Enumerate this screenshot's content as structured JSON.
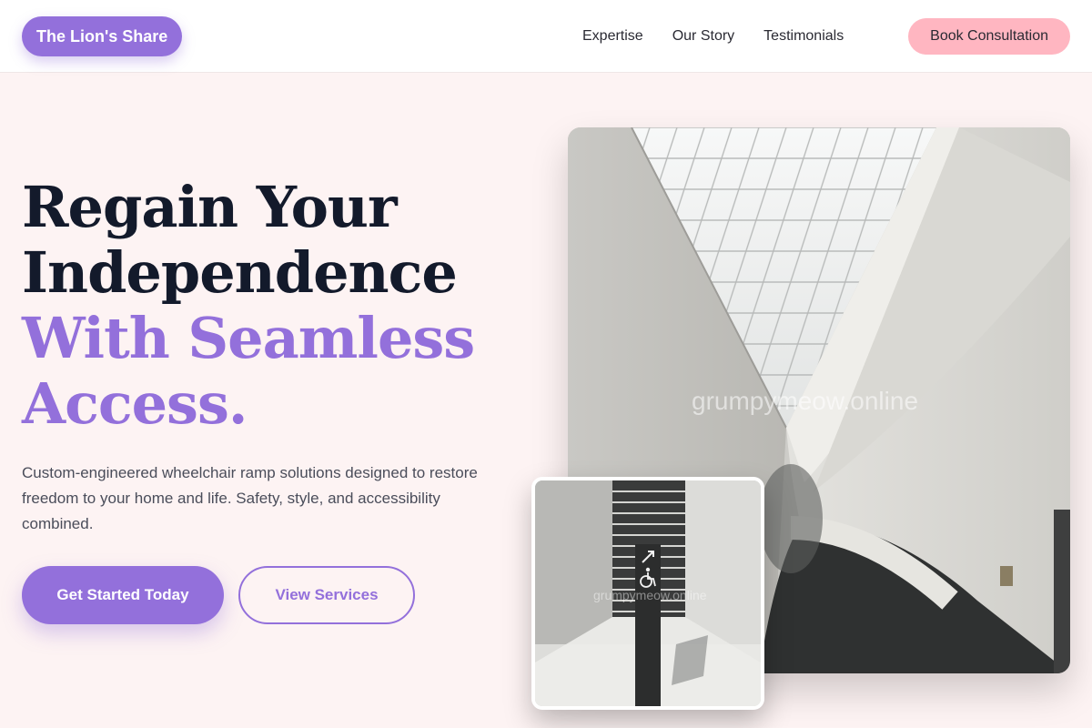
{
  "nav": {
    "brand": "The Lion's Share",
    "links": [
      "Expertise",
      "Our Story",
      "Testimonials"
    ],
    "cta": "Book Consultation"
  },
  "hero": {
    "title_line1": "Regain Your",
    "title_line2": "Independence",
    "title_accent_line1": "With Seamless",
    "title_accent_line2": "Access.",
    "subtitle": "Custom-engineered wheelchair ramp solutions designed to restore freedom to your home and life. Safety, style, and accessibility combined.",
    "primary_button": "Get Started Today",
    "secondary_button": "View Services"
  },
  "images": {
    "main_watermark": "grumpymeow.online",
    "inset_watermark": "grumpymeow.online"
  },
  "colors": {
    "accent": "#9370db",
    "cta_pink": "#ffb6c1",
    "background": "#fdf3f3",
    "heading_dark": "#131a2b"
  }
}
